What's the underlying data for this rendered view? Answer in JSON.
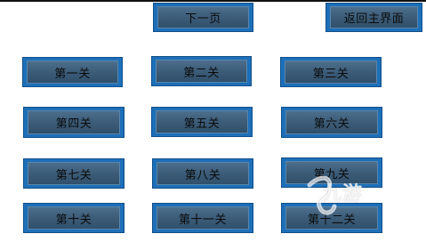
{
  "nav": {
    "next_page": "下一页",
    "back_to_main": "返回主界面"
  },
  "levels": [
    "第一关",
    "第二关",
    "第三关",
    "第四关",
    "第五关",
    "第六关",
    "第七关",
    "第八关",
    "第九关",
    "第十关",
    "第十一关",
    "第十二关"
  ],
  "watermark": {
    "text": "九游"
  },
  "colors": {
    "button_border": "#1d6fb8",
    "button_face": "#3c5c78",
    "text": "#0b0b0b"
  }
}
